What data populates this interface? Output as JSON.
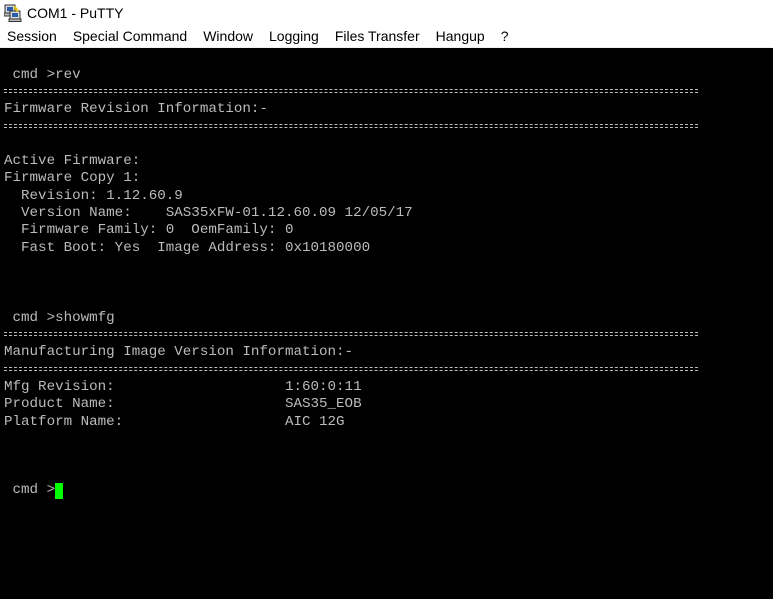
{
  "window": {
    "title": "COM1 - PuTTY",
    "icon": "putty-computer-icon"
  },
  "menu": {
    "items": [
      "Session",
      "Special Command",
      "Window",
      "Logging",
      "Files Transfer",
      "Hangup",
      "?"
    ]
  },
  "terminal": {
    "lines": {
      "cmd_rev": " cmd >rev",
      "fw_header": "Firmware Revision Information:-",
      "active_fw": "Active Firmware:",
      "fw_copy": "Firmware Copy 1:",
      "revision": "  Revision: 1.12.60.9",
      "version_name": "  Version Name:    SAS35xFW-01.12.60.09 12/05/17",
      "fw_family": "  Firmware Family: 0  OemFamily: 0",
      "fast_boot": "  Fast Boot: Yes  Image Address: 0x10180000",
      "cmd_showmfg": " cmd >showmfg",
      "mfg_header": "Manufacturing Image Version Information:-",
      "mfg_revision": "Mfg Revision:                    1:60:0:11",
      "product_name": "Product Name:                    SAS35_EOB",
      "platform_name": "Platform Name:                   AIC 12G",
      "prompt": " cmd >"
    },
    "colors": {
      "background": "#000000",
      "foreground": "#bbbbbb",
      "cursor": "#00ff00"
    }
  }
}
